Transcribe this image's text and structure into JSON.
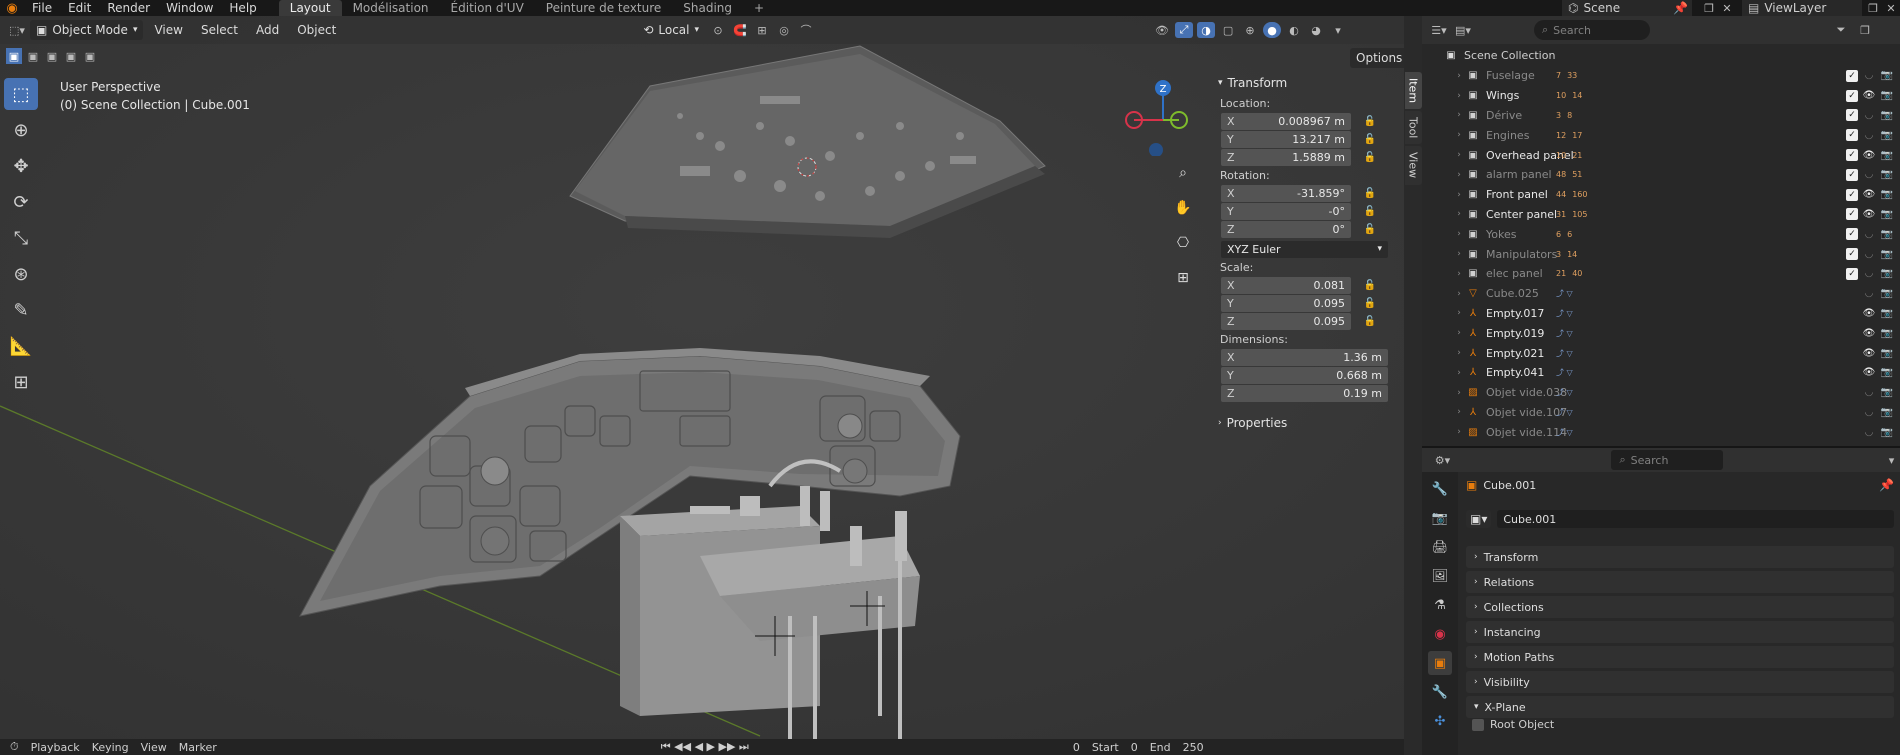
{
  "app": {
    "title": "Blender"
  },
  "menu": [
    "File",
    "Edit",
    "Render",
    "Window",
    "Help"
  ],
  "workspaces": [
    {
      "label": "Layout",
      "active": true
    },
    {
      "label": "Modélisation",
      "active": false
    },
    {
      "label": "Édition d'UV",
      "active": false
    },
    {
      "label": "Peinture de texture",
      "active": false
    },
    {
      "label": "Shading",
      "active": false
    }
  ],
  "add_workspace": "+",
  "scene": {
    "name": "Scene",
    "view_layer": "ViewLayer"
  },
  "viewport_header": {
    "mode": "Object Mode",
    "menus": [
      "View",
      "Select",
      "Add",
      "Object"
    ],
    "transform_orientation": "Local",
    "options": "Options"
  },
  "viewport_info": {
    "perspective": "User Perspective",
    "context": "(0) Scene Collection | Cube.001"
  },
  "gizmo": {
    "z": "Z"
  },
  "npanel": {
    "transform_title": "Transform",
    "location_label": "Location:",
    "location": [
      {
        "axis": "X",
        "value": "0.008967 m"
      },
      {
        "axis": "Y",
        "value": "13.217 m"
      },
      {
        "axis": "Z",
        "value": "1.5889 m"
      }
    ],
    "rotation_label": "Rotation:",
    "rotation": [
      {
        "axis": "X",
        "value": "-31.859°"
      },
      {
        "axis": "Y",
        "value": "-0°"
      },
      {
        "axis": "Z",
        "value": "0°"
      }
    ],
    "rotation_mode": "XYZ Euler",
    "scale_label": "Scale:",
    "scale": [
      {
        "axis": "X",
        "value": "0.081"
      },
      {
        "axis": "Y",
        "value": "0.095"
      },
      {
        "axis": "Z",
        "value": "0.095"
      }
    ],
    "dimensions_label": "Dimensions:",
    "dimensions": [
      {
        "axis": "X",
        "value": "1.36 m"
      },
      {
        "axis": "Y",
        "value": "0.668 m"
      },
      {
        "axis": "Z",
        "value": "0.19 m"
      }
    ],
    "properties_title": "Properties"
  },
  "side_tabs": [
    "Item",
    "Tool",
    "View"
  ],
  "outliner": {
    "search_placeholder": "Search",
    "root": "Scene Collection",
    "rows": [
      {
        "name": "Fuselage",
        "type": "collection",
        "counts": [
          "7",
          "33"
        ],
        "checked": true,
        "visible": false,
        "dim": true
      },
      {
        "name": "Wings",
        "type": "collection",
        "counts": [
          "10",
          "14"
        ],
        "checked": true,
        "visible": true,
        "dim": false
      },
      {
        "name": "Dérive",
        "type": "collection",
        "counts": [
          "3",
          "8"
        ],
        "checked": true,
        "visible": false,
        "dim": true
      },
      {
        "name": "Engines",
        "type": "collection",
        "counts": [
          "12",
          "17"
        ],
        "checked": true,
        "visible": false,
        "dim": true
      },
      {
        "name": "Overhead panel",
        "type": "collection",
        "counts": [
          "10",
          "21"
        ],
        "checked": true,
        "visible": true,
        "dim": false
      },
      {
        "name": "alarm panel",
        "type": "collection",
        "counts": [
          "48",
          "51"
        ],
        "checked": true,
        "visible": false,
        "dim": true
      },
      {
        "name": "Front panel",
        "type": "collection",
        "counts": [
          "44",
          "160"
        ],
        "checked": true,
        "visible": true,
        "dim": false
      },
      {
        "name": "Center panel",
        "type": "collection",
        "counts": [
          "31",
          "105"
        ],
        "checked": true,
        "visible": true,
        "dim": false
      },
      {
        "name": "Yokes",
        "type": "collection",
        "counts": [
          "6",
          "6"
        ],
        "checked": true,
        "visible": false,
        "dim": true
      },
      {
        "name": "Manipulators",
        "type": "collection",
        "counts": [
          "3",
          "14"
        ],
        "checked": true,
        "visible": false,
        "dim": true
      },
      {
        "name": "elec panel",
        "type": "collection",
        "counts": [
          "21",
          "40"
        ],
        "checked": true,
        "visible": false,
        "dim": true
      },
      {
        "name": "Cube.025",
        "type": "mesh",
        "counts": [],
        "checked": false,
        "visible": false,
        "dim": true
      },
      {
        "name": "Empty.017",
        "type": "empty",
        "counts": [],
        "checked": false,
        "visible": true,
        "dim": false
      },
      {
        "name": "Empty.019",
        "type": "empty",
        "counts": [],
        "checked": false,
        "visible": true,
        "dim": false
      },
      {
        "name": "Empty.021",
        "type": "empty",
        "counts": [],
        "checked": false,
        "visible": true,
        "dim": false
      },
      {
        "name": "Empty.041",
        "type": "empty",
        "counts": [],
        "checked": false,
        "visible": true,
        "dim": false
      },
      {
        "name": "Objet vide.038",
        "type": "image-empty",
        "counts": [],
        "checked": false,
        "visible": false,
        "dim": true
      },
      {
        "name": "Objet vide.107",
        "type": "empty",
        "counts": [],
        "checked": false,
        "visible": false,
        "dim": true
      },
      {
        "name": "Objet vide.114",
        "type": "image-empty",
        "counts": [],
        "checked": false,
        "visible": false,
        "dim": true
      }
    ]
  },
  "properties": {
    "search_placeholder": "Search",
    "object_name": "Cube.001",
    "object_field": "Cube.001",
    "sections": [
      "Transform",
      "Relations",
      "Collections",
      "Instancing",
      "Motion Paths",
      "Visibility",
      "X-Plane"
    ],
    "root_object_label": "Root Object"
  },
  "timeline": {
    "items": [
      "Playback",
      "Keying",
      "View",
      "Marker"
    ],
    "frame": "0",
    "start": "Start",
    "start_val": "0",
    "end": "End",
    "end_val": "250"
  },
  "colors": {
    "accent": "#4772b3",
    "orange": "#e87d0d",
    "gizmo_x": "#d7334a",
    "gizmo_y": "#7ebc2c",
    "gizmo_z": "#2f72c8"
  }
}
